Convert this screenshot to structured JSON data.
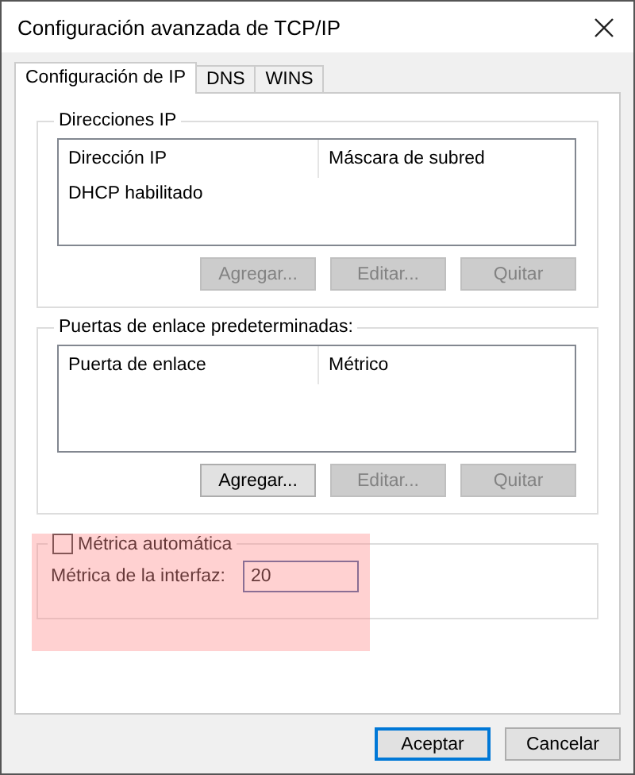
{
  "window": {
    "title": "Configuración avanzada de TCP/IP"
  },
  "tabs": [
    {
      "label": "Configuración de IP",
      "selected": true
    },
    {
      "label": "DNS",
      "selected": false
    },
    {
      "label": "WINS",
      "selected": false
    }
  ],
  "ip_addresses": {
    "legend": "Direcciones IP",
    "columns": [
      "Dirección IP",
      "Máscara de subred"
    ],
    "rows": [
      [
        "DHCP habilitado"
      ]
    ],
    "buttons": [
      {
        "label": "Agregar...",
        "disabled": true
      },
      {
        "label": "Editar...",
        "disabled": true
      },
      {
        "label": "Quitar",
        "disabled": true
      }
    ]
  },
  "gateways": {
    "legend": "Puertas de enlace predeterminadas:",
    "columns": [
      "Puerta de enlace",
      "Métrico"
    ],
    "buttons": [
      {
        "label": "Agregar...",
        "disabled": false
      },
      {
        "label": "Editar...",
        "disabled": true
      },
      {
        "label": "Quitar",
        "disabled": true
      }
    ]
  },
  "metric": {
    "automatic": {
      "label": "Métrica automática",
      "checked": false
    },
    "interface_metric": {
      "label": "Métrica de la interfaz:",
      "value": "20"
    }
  },
  "footer_buttons": [
    {
      "label": "Aceptar",
      "default": true
    },
    {
      "label": "Cancelar",
      "default": false
    }
  ]
}
